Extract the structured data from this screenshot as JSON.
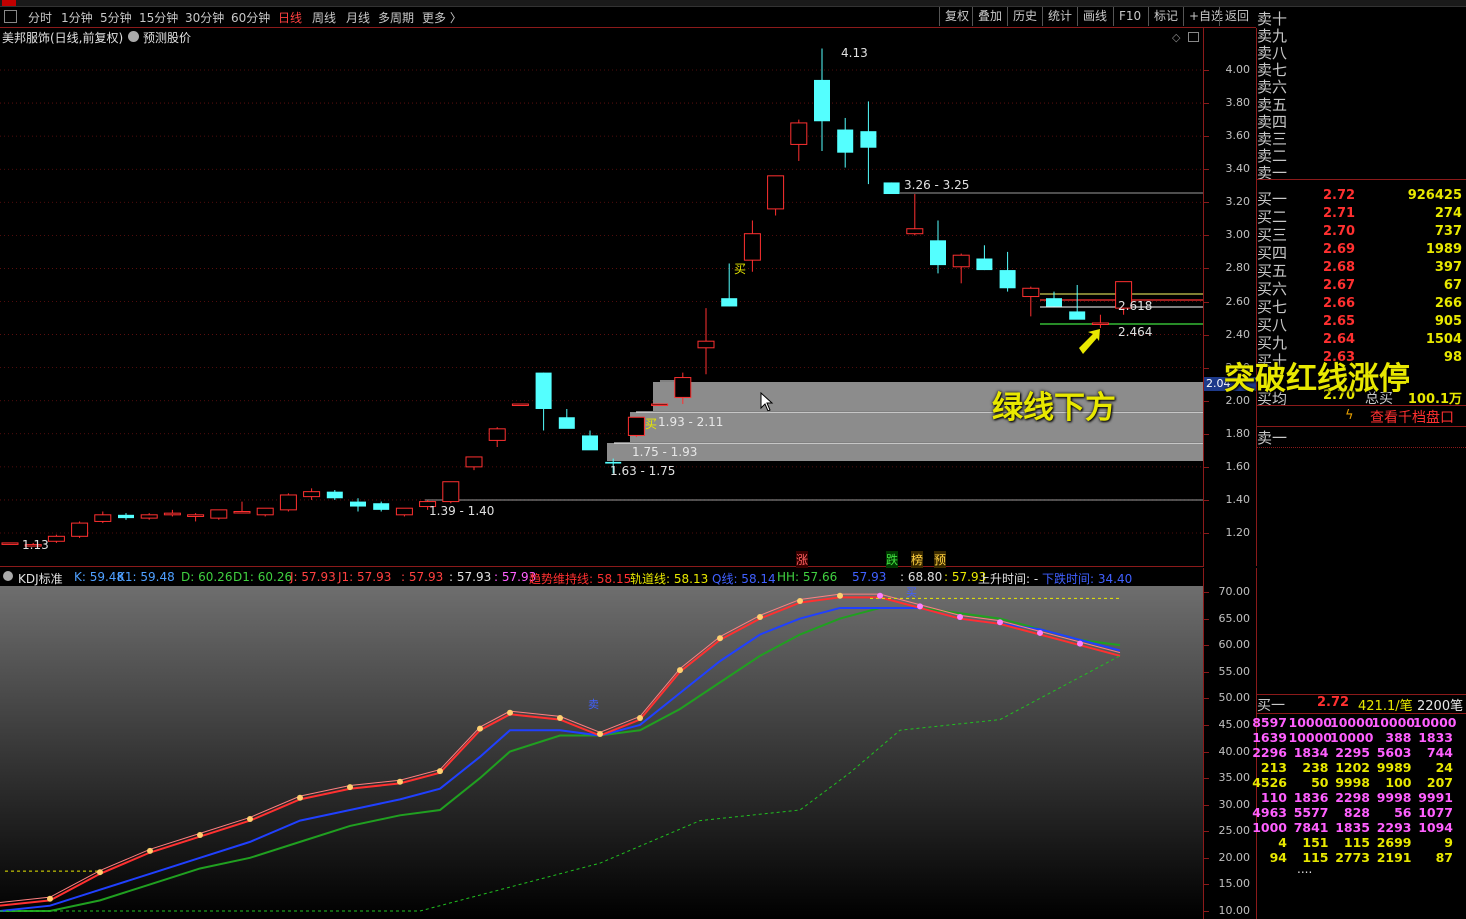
{
  "colors": {
    "up": "#ff3030",
    "down": "#54ffff",
    "grid": "#8b1a1a",
    "axis_text": "#c0c0c0"
  },
  "toolbar": {
    "periods": [
      "分时",
      "1分钟",
      "5分钟",
      "15分钟",
      "30分钟",
      "60分钟",
      "日线",
      "周线",
      "月线",
      "多周期",
      "更多 〉"
    ],
    "active_period": "日线",
    "buttons": [
      "复权",
      "叠加",
      "历史",
      "统计",
      "画线",
      "F10",
      "标记",
      "+自选",
      "返回"
    ]
  },
  "chart_header": {
    "title": "美邦服饰(日线,前复权)",
    "forecast_label": "预测股价"
  },
  "price_axis": [
    "4.00",
    "3.80",
    "3.60",
    "3.40",
    "3.20",
    "3.00",
    "2.80",
    "2.60",
    "2.40",
    "2.20",
    "2.00",
    "1.80",
    "1.60",
    "1.40",
    "1.20"
  ],
  "current_price_tag": "2.04",
  "annotations": {
    "high": "4.13",
    "low_left": "1.13",
    "range_326": "3.26 - 3.25",
    "val_2618": "2.618",
    "val_2464": "2.464",
    "zone_193_211": "1.93 - 2.11",
    "zone_buy": "买",
    "zone_175_193": "1.75 - 1.93",
    "range_163": "1.63 - 1.75",
    "range_139": "1.39 - 1.40",
    "buy_marker": "买",
    "signals": [
      "涨",
      "跌",
      "榜",
      "预"
    ],
    "overlay_red_line": "突破红线涨停",
    "overlay_green_line": "绿线下方"
  },
  "kdj_header": {
    "name": "KDJ标准",
    "items": [
      {
        "text": "K: 59.48",
        "color": "#4fa0ff"
      },
      {
        "text": "K1: 59.48",
        "color": "#4fa0ff"
      },
      {
        "text": "D: 60.26",
        "color": "#40d040"
      },
      {
        "text": "D1: 60.26",
        "color": "#40d040"
      },
      {
        "text": "J: 57.93",
        "color": "#ff4040"
      },
      {
        "text": "J1: 57.93",
        "color": "#ff4040"
      },
      {
        "text": ": 57.93",
        "color": "#ff4040"
      },
      {
        "text": ": 57.93",
        "color": "#e0e0e0"
      },
      {
        "text": ": 57.93",
        "color": "#ff60ff"
      },
      {
        "text": "趋势维持线: 58.15",
        "color": "#ff3030"
      },
      {
        "text": "轨道线: 58.13",
        "color": "#e8e800"
      },
      {
        "text": "Q线: 58.14",
        "color": "#4060ff"
      },
      {
        "text": "HH: 57.66",
        "color": "#40d040"
      },
      {
        "text": "57.93",
        "color": "#4060ff"
      },
      {
        "text": ": 68.80",
        "color": "#e0e0e0"
      },
      {
        "text": ": 57.93",
        "color": "#e8e800"
      },
      {
        "text": "上升时间: -",
        "color": "#e0e0e0"
      },
      {
        "text": "下跌时间: 34.40",
        "color": "#4060ff"
      }
    ],
    "marker_sell": "卖",
    "marker_buy": "买"
  },
  "kdj_axis": [
    "70.00",
    "65.00",
    "60.00",
    "55.00",
    "50.00",
    "45.00",
    "40.00",
    "35.00",
    "30.00",
    "25.00",
    "20.00",
    "15.00",
    "10.00"
  ],
  "order_book": {
    "sells": [
      "卖十",
      "卖九",
      "卖八",
      "卖七",
      "卖六",
      "卖五",
      "卖四",
      "卖三",
      "卖二",
      "卖一"
    ],
    "buys": [
      {
        "label": "买一",
        "price": "2.72",
        "vol": "926425"
      },
      {
        "label": "买二",
        "price": "2.71",
        "vol": "274"
      },
      {
        "label": "买三",
        "price": "2.70",
        "vol": "737"
      },
      {
        "label": "买四",
        "price": "2.69",
        "vol": "1989"
      },
      {
        "label": "买五",
        "price": "2.68",
        "vol": "397"
      },
      {
        "label": "买六",
        "price": "2.67",
        "vol": "67"
      },
      {
        "label": "买七",
        "price": "2.66",
        "vol": "266"
      },
      {
        "label": "买八",
        "price": "2.65",
        "vol": "905"
      },
      {
        "label": "买九",
        "price": "2.64",
        "vol": "1504"
      },
      {
        "label": "买十",
        "price": "2.63",
        "vol": "98"
      }
    ],
    "avg_label": "买均",
    "avg_price": "2.70",
    "total_label": "总买",
    "total_value": "100.1万",
    "link": "查看千档盘口",
    "sell1_label": "卖一",
    "bottom_buy": {
      "label": "买一",
      "price": "2.72",
      "detail": "421.1/笔",
      "count": "2200笔"
    },
    "queue": [
      [
        "8597",
        "10000",
        "10000",
        "10000",
        "10000"
      ],
      [
        "1639",
        "10000",
        "10000",
        "388",
        "1833"
      ],
      [
        "2296",
        "1834",
        "2295",
        "5603",
        "744"
      ],
      [
        "213",
        "238",
        "1202",
        "9989",
        "24"
      ],
      [
        "4526",
        "50",
        "9998",
        "100",
        "207"
      ],
      [
        "110",
        "1836",
        "2298",
        "9998",
        "9991"
      ],
      [
        "4963",
        "5577",
        "828",
        "56",
        "1077"
      ],
      [
        "1000",
        "7841",
        "1835",
        "2293",
        "1094"
      ],
      [
        "4",
        "151",
        "115",
        "2699",
        "9"
      ],
      [
        "94",
        "115",
        "2773",
        "2191",
        "87"
      ]
    ],
    "more": "...."
  },
  "chart_data": {
    "type": "candlestick",
    "title": "美邦服饰(日线,前复权)",
    "ylim": [
      1.1,
      4.2
    ],
    "candles": [
      [
        1.14,
        1.14,
        1.13,
        1.14
      ],
      [
        1.13,
        1.14,
        1.12,
        1.13
      ],
      [
        1.15,
        1.19,
        1.14,
        1.18
      ],
      [
        1.18,
        1.27,
        1.17,
        1.26
      ],
      [
        1.27,
        1.33,
        1.26,
        1.31
      ],
      [
        1.31,
        1.32,
        1.28,
        1.29
      ],
      [
        1.29,
        1.32,
        1.28,
        1.31
      ],
      [
        1.31,
        1.34,
        1.3,
        1.32
      ],
      [
        1.3,
        1.32,
        1.27,
        1.31
      ],
      [
        1.29,
        1.33,
        1.28,
        1.34
      ],
      [
        1.33,
        1.39,
        1.32,
        1.33
      ],
      [
        1.31,
        1.35,
        1.3,
        1.35
      ],
      [
        1.34,
        1.44,
        1.33,
        1.43
      ],
      [
        1.42,
        1.47,
        1.4,
        1.45
      ],
      [
        1.45,
        1.46,
        1.4,
        1.41
      ],
      [
        1.39,
        1.41,
        1.33,
        1.36
      ],
      [
        1.38,
        1.39,
        1.33,
        1.34
      ],
      [
        1.31,
        1.35,
        1.3,
        1.35
      ],
      [
        1.36,
        1.4,
        1.34,
        1.39
      ],
      [
        1.39,
        1.51,
        1.38,
        1.51
      ],
      [
        1.6,
        1.66,
        1.58,
        1.66
      ],
      [
        1.76,
        1.84,
        1.72,
        1.83
      ],
      [
        1.98,
        1.98,
        1.98,
        1.98
      ],
      [
        2.17,
        2.17,
        1.82,
        1.95
      ],
      [
        1.9,
        1.95,
        1.85,
        1.83
      ],
      [
        1.79,
        1.82,
        1.73,
        1.7
      ],
      [
        1.63,
        1.65,
        1.56,
        1.62
      ],
      [
        1.79,
        1.9,
        1.78,
        1.9
      ],
      [
        1.98,
        1.98,
        1.97,
        1.98
      ],
      [
        2.02,
        2.17,
        1.98,
        2.14
      ],
      [
        2.32,
        2.56,
        2.16,
        2.36
      ],
      [
        2.62,
        2.83,
        2.57,
        2.57
      ],
      [
        2.85,
        3.09,
        2.78,
        3.01
      ],
      [
        3.16,
        3.36,
        3.12,
        3.36
      ],
      [
        3.55,
        3.7,
        3.45,
        3.68
      ],
      [
        3.94,
        4.13,
        3.51,
        3.69
      ],
      [
        3.64,
        3.71,
        3.41,
        3.5
      ],
      [
        3.63,
        3.81,
        3.31,
        3.53
      ],
      [
        3.32,
        3.32,
        3.26,
        3.25
      ],
      [
        3.01,
        3.25,
        3.0,
        3.04
      ],
      [
        2.97,
        3.09,
        2.77,
        2.82
      ],
      [
        2.81,
        2.89,
        2.71,
        2.88
      ],
      [
        2.86,
        2.94,
        2.79,
        2.79
      ],
      [
        2.79,
        2.9,
        2.66,
        2.68
      ],
      [
        2.63,
        2.69,
        2.51,
        2.68
      ],
      [
        2.62,
        2.66,
        2.57,
        2.57
      ],
      [
        2.54,
        2.7,
        2.51,
        2.49
      ],
      [
        2.47,
        2.52,
        2.44,
        2.47
      ],
      [
        2.56,
        2.72,
        2.52,
        2.72
      ]
    ]
  }
}
